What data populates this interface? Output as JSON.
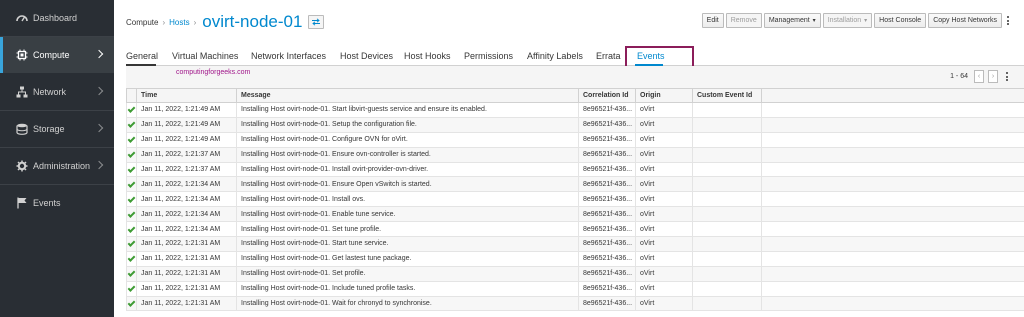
{
  "sidebar": {
    "items": [
      {
        "label": "Dashboard",
        "icon": "dashboard-icon",
        "active": false,
        "chevron": false
      },
      {
        "label": "Compute",
        "icon": "compute-icon",
        "active": true,
        "chevron": true
      },
      {
        "label": "Network",
        "icon": "network-icon",
        "active": false,
        "chevron": true
      },
      {
        "label": "Storage",
        "icon": "storage-icon",
        "active": false,
        "chevron": true
      },
      {
        "label": "Administration",
        "icon": "gear-icon",
        "active": false,
        "chevron": true
      },
      {
        "label": "Events",
        "icon": "flag-icon",
        "active": false,
        "chevron": false
      }
    ]
  },
  "header": {
    "breadcrumb_compute": "Compute",
    "breadcrumb_hosts": "Hosts",
    "title": "ovirt-node-01"
  },
  "actions": {
    "edit": "Edit",
    "remove": "Remove",
    "management": "Management",
    "installation": "Installation",
    "host_console": "Host Console",
    "copy_host_networks": "Copy Host Networks"
  },
  "tabs": [
    "General",
    "Virtual Machines",
    "Network Interfaces",
    "Host Devices",
    "Host Hooks",
    "Permissions",
    "Affinity Labels",
    "Errata",
    "Events"
  ],
  "watermark": "computingforgeeks.com",
  "pager": {
    "range": "1 - 64"
  },
  "table": {
    "columns": [
      "Time",
      "Message",
      "Correlation Id",
      "Origin",
      "Custom Event Id"
    ],
    "rows": [
      [
        "Jan 11, 2022, 1:21:49 AM",
        "Installing Host ovirt-node-01. Start libvirt-guests service and ensure its enabled.",
        "8e96521f-436...",
        "oVirt",
        ""
      ],
      [
        "Jan 11, 2022, 1:21:49 AM",
        "Installing Host ovirt-node-01. Setup the configuration file.",
        "8e96521f-436...",
        "oVirt",
        ""
      ],
      [
        "Jan 11, 2022, 1:21:49 AM",
        "Installing Host ovirt-node-01. Configure OVN for oVirt.",
        "8e96521f-436...",
        "oVirt",
        ""
      ],
      [
        "Jan 11, 2022, 1:21:37 AM",
        "Installing Host ovirt-node-01. Ensure ovn-controller is started.",
        "8e96521f-436...",
        "oVirt",
        ""
      ],
      [
        "Jan 11, 2022, 1:21:37 AM",
        "Installing Host ovirt-node-01. Install ovirt-provider-ovn-driver.",
        "8e96521f-436...",
        "oVirt",
        ""
      ],
      [
        "Jan 11, 2022, 1:21:34 AM",
        "Installing Host ovirt-node-01. Ensure Open vSwitch is started.",
        "8e96521f-436...",
        "oVirt",
        ""
      ],
      [
        "Jan 11, 2022, 1:21:34 AM",
        "Installing Host ovirt-node-01. Install ovs.",
        "8e96521f-436...",
        "oVirt",
        ""
      ],
      [
        "Jan 11, 2022, 1:21:34 AM",
        "Installing Host ovirt-node-01. Enable tune service.",
        "8e96521f-436...",
        "oVirt",
        ""
      ],
      [
        "Jan 11, 2022, 1:21:34 AM",
        "Installing Host ovirt-node-01. Set tune profile.",
        "8e96521f-436...",
        "oVirt",
        ""
      ],
      [
        "Jan 11, 2022, 1:21:31 AM",
        "Installing Host ovirt-node-01. Start tune service.",
        "8e96521f-436...",
        "oVirt",
        ""
      ],
      [
        "Jan 11, 2022, 1:21:31 AM",
        "Installing Host ovirt-node-01. Get lastest tune package.",
        "8e96521f-436...",
        "oVirt",
        ""
      ],
      [
        "Jan 11, 2022, 1:21:31 AM",
        "Installing Host ovirt-node-01. Set profile.",
        "8e96521f-436...",
        "oVirt",
        ""
      ],
      [
        "Jan 11, 2022, 1:21:31 AM",
        "Installing Host ovirt-node-01. Include tuned profile tasks.",
        "8e96521f-436...",
        "oVirt",
        ""
      ],
      [
        "Jan 11, 2022, 1:21:31 AM",
        "Installing Host ovirt-node-01. Wait for chronyd to synchronise.",
        "8e96521f-436...",
        "oVirt",
        ""
      ]
    ]
  }
}
